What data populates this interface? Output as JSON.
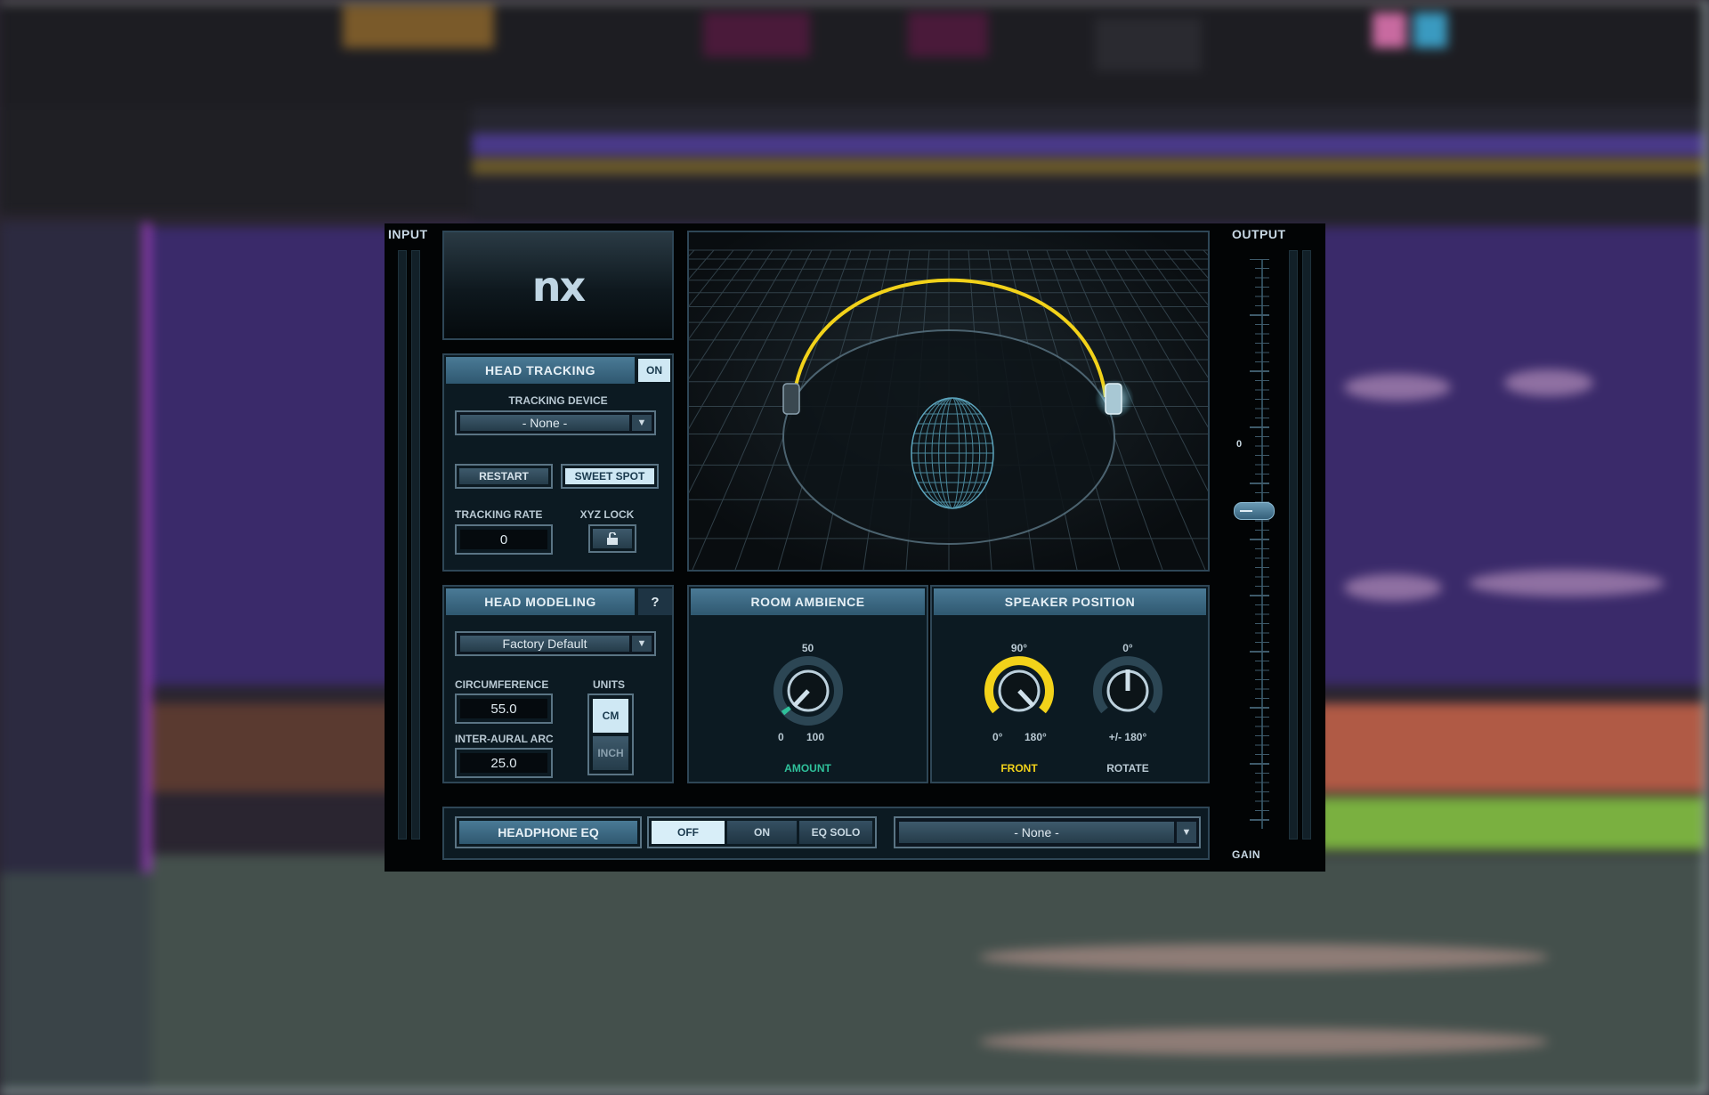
{
  "plugin": {
    "input_label": "INPUT",
    "output_label": "OUTPUT",
    "gain_label": "GAIN",
    "gain_scale_zero": "0",
    "logo_text": "nx",
    "head_tracking": {
      "title": "HEAD TRACKING",
      "toggle": "ON",
      "device_label": "TRACKING DEVICE",
      "device_value": "- None -",
      "restart": "RESTART",
      "sweet_spot": "SWEET SPOT",
      "rate_label": "TRACKING RATE",
      "rate_value": "0",
      "xyz_label": "XYZ LOCK"
    },
    "head_modeling": {
      "title": "HEAD MODELING",
      "help": "?",
      "preset": "Factory Default",
      "circumference_label": "CIRCUMFERENCE",
      "circumference_value": "55.0",
      "arc_label": "INTER-AURAL  ARC",
      "arc_value": "25.0",
      "units_label": "UNITS",
      "unit_cm": "CM",
      "unit_inch": "INCH"
    },
    "room_ambience": {
      "title": "ROOM AMBIENCE",
      "top": "50",
      "min": "0",
      "max": "100",
      "knob_label": "AMOUNT"
    },
    "speaker_position": {
      "title": "SPEAKER POSITION",
      "front_top": "90°",
      "front_min": "0°",
      "front_max": "180°",
      "front_label": "FRONT",
      "rotate_top": "0°",
      "rotate_range": "+/- 180°",
      "rotate_label": "ROTATE"
    },
    "headphone_eq": {
      "title": "HEADPHONE EQ",
      "off": "OFF",
      "on": "ON",
      "solo": "EQ SOLO",
      "preset": "- None -"
    },
    "colors": {
      "accent_yellow": "#f2d21a",
      "accent_teal": "#2fc09a",
      "header_blue": "#3d6a84"
    }
  }
}
